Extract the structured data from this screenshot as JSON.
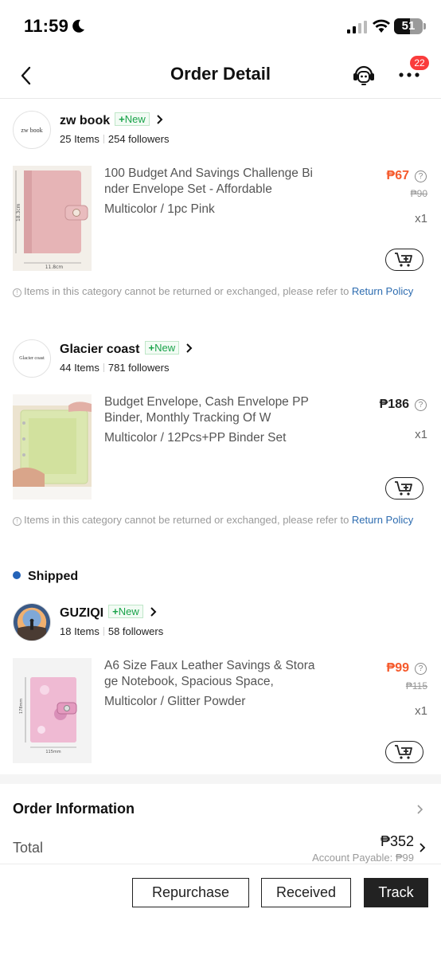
{
  "status_bar": {
    "time": "11:59",
    "battery": "51"
  },
  "header": {
    "title": "Order Detail",
    "badge_count": "22"
  },
  "stores": [
    {
      "avatar_text": "zw book",
      "name": "zw book",
      "new_label": "New",
      "items": "25 Items",
      "followers": "254 followers",
      "product": {
        "title": "100 Budget And Savings Challenge Binder Envelope Set - Affordable",
        "variant": "Multicolor / 1pc Pink",
        "price": "₱67",
        "old_price": "₱90",
        "qty": "x1",
        "img_label_h": "18.3cm",
        "img_label_w": "11.8cm"
      },
      "notice": "Items in this category cannot be returned or exchanged, please refer to ",
      "notice_link": "Return Policy"
    },
    {
      "avatar_text": "Glacier coast",
      "name": "Glacier coast",
      "new_label": "New",
      "items": "44 Items",
      "followers": "781 followers",
      "product": {
        "title": "Budget Envelope, Cash Envelope PP Binder, Monthly Tracking Of W",
        "variant": "Multicolor / 12Pcs+PP Binder Set",
        "price": "₱186",
        "qty": "x1"
      },
      "notice": "Items in this category cannot be returned or exchanged, please refer to ",
      "notice_link": "Return Policy"
    },
    {
      "name": "GUZIQI",
      "new_label": "New",
      "items": "18 Items",
      "followers": "58 followers",
      "product": {
        "title": "A6 Size Faux Leather Savings & Storage Notebook, Spacious Space,",
        "variant": "Multicolor / Glitter Powder",
        "price": "₱99",
        "old_price": "₱115",
        "qty": "x1",
        "img_label_h": "178mm",
        "img_label_w": "115mm"
      }
    }
  ],
  "shipped_label": "Shipped",
  "order_info": {
    "title": "Order Information",
    "total_label": "Total",
    "total_value": "₱352",
    "account_payable": "Account Payable: ₱99"
  },
  "actions": {
    "repurchase": "Repurchase",
    "received": "Received",
    "track": "Track"
  },
  "colors": {
    "price_red": "#f55a2c",
    "new_green": "#1aa34a",
    "link_blue": "#2d6cb0",
    "shipped_dot": "#2463b8",
    "badge_red": "#fa3c3c"
  }
}
